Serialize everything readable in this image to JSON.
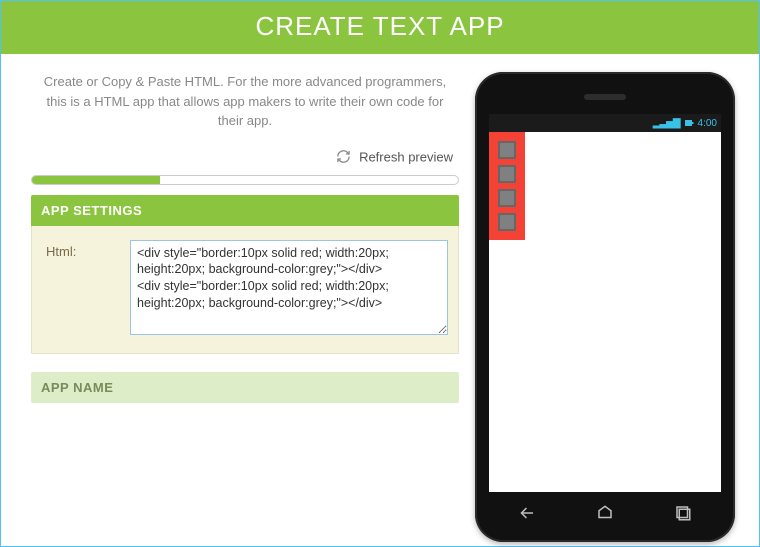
{
  "header": {
    "title": "CREATE TEXT APP"
  },
  "intro": "Create or Copy & Paste HTML. For the more advanced programmers, this is a HTML app that allows app makers to write their own code for their app.",
  "refresh": {
    "label": "Refresh preview"
  },
  "progress": {
    "percent": 30
  },
  "panels": {
    "settings": {
      "title": "APP SETTINGS",
      "html_label": "Html:",
      "html_value": "<div style=\"border:10px solid red; width:20px; height:20px; background-color:grey;\"></div>\n<div style=\"border:10px solid red; width:20px; height:20px; background-color:grey;\"></div>"
    },
    "name": {
      "title": "APP NAME"
    }
  },
  "phone": {
    "status": {
      "time": "4:00",
      "signal": "▂▃▅▇"
    },
    "preview_boxes": 4
  },
  "colors": {
    "accent": "#8bc53f",
    "accent_pale": "#dcedc8",
    "panel_bg": "#f6f3dd"
  }
}
